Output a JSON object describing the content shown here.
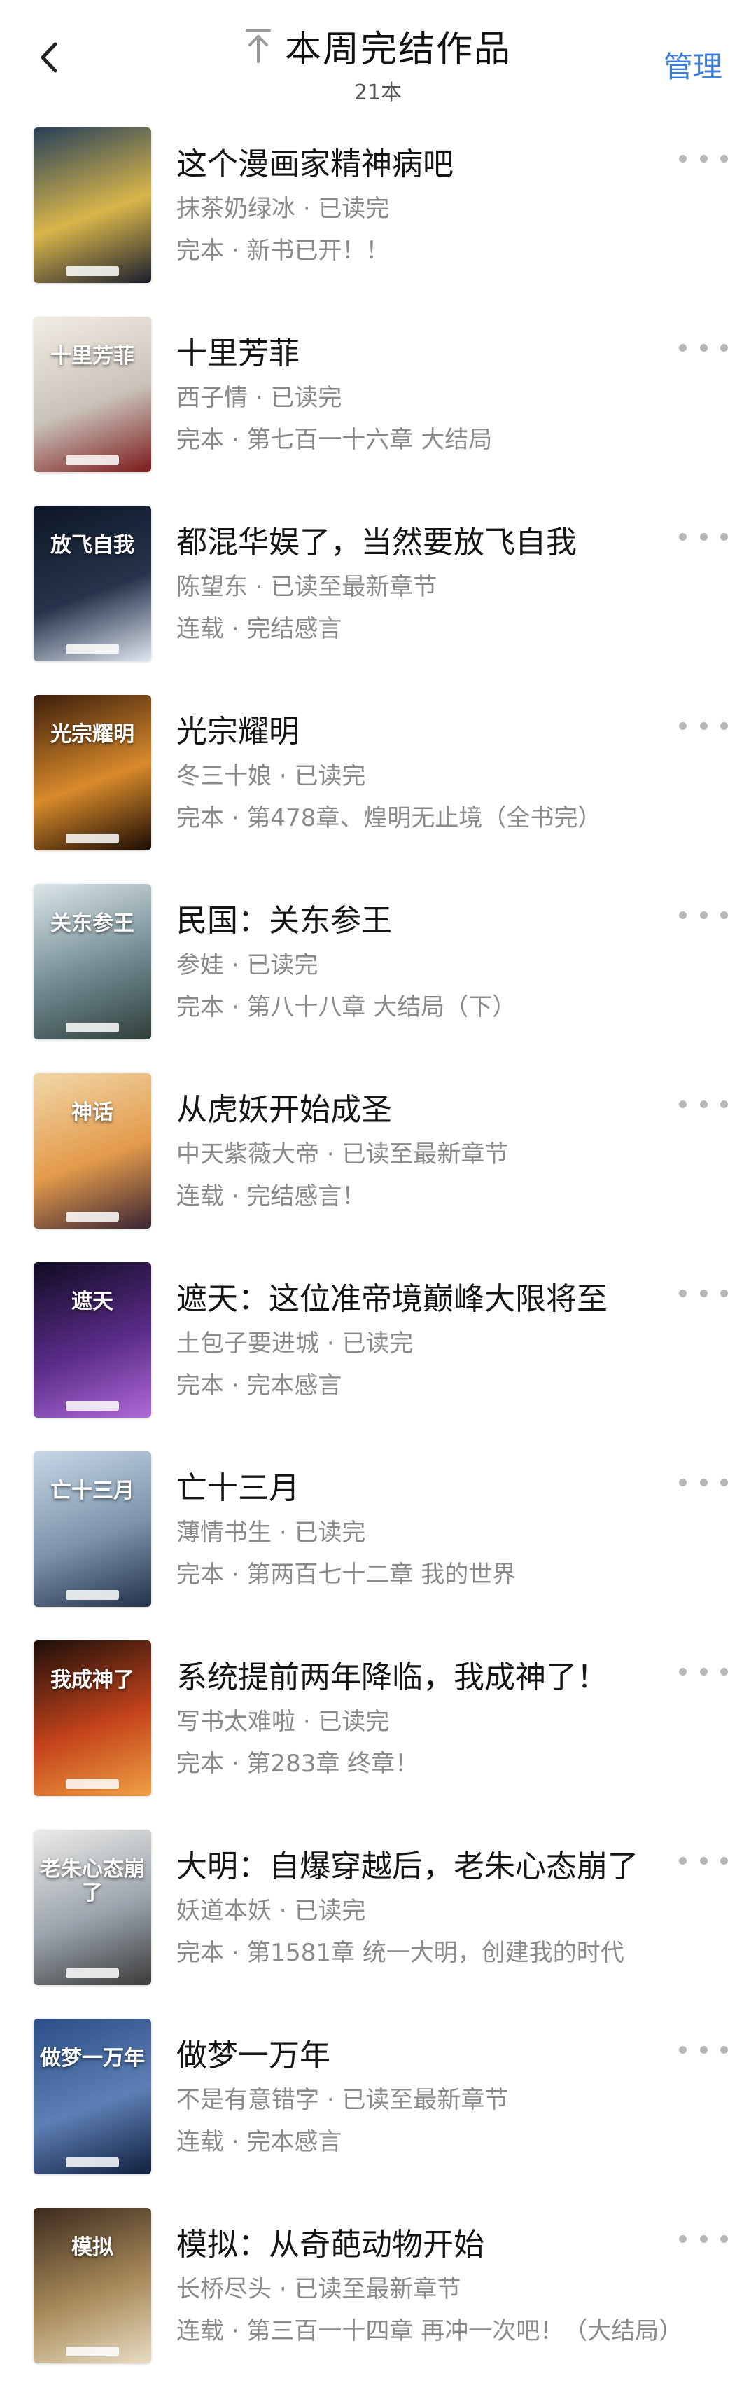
{
  "header": {
    "back_icon": "chevron-left-icon",
    "pin_icon": "pin-top-icon",
    "title": "本周完结作品",
    "subtitle": "21本",
    "manage_label": "管理",
    "accent_color": "#3b7dd8"
  },
  "books": [
    {
      "title": "这个漫画家精神病吧",
      "author": "抹茶奶绿冰",
      "progress": "已读完",
      "serial": "完本",
      "latest": "新书已开！！",
      "cover_text": "",
      "cover_colors": [
        "#26405a",
        "#d9b64a",
        "#1c1f2e"
      ]
    },
    {
      "title": "十里芳菲",
      "author": "西子情",
      "progress": "已读完",
      "serial": "完本",
      "latest": "第七百一十六章 大结局",
      "cover_text": "十里芳菲",
      "cover_colors": [
        "#f2ede4",
        "#c9c2b8",
        "#7b1a1a"
      ]
    },
    {
      "title": "都混华娱了，当然要放飞自我",
      "author": "陈望东",
      "progress": "已读至最新章节",
      "serial": "连载",
      "latest": "完结感言",
      "cover_text": "放飞自我",
      "cover_colors": [
        "#0d1626",
        "#25344c",
        "#dfe6f0"
      ]
    },
    {
      "title": "光宗耀明",
      "author": "冬三十娘",
      "progress": "已读完",
      "serial": "完本",
      "latest": "第478章、煌明无止境（全书完）",
      "cover_text": "光宗耀明",
      "cover_colors": [
        "#3b1e0c",
        "#d98a2b",
        "#1a0b04"
      ]
    },
    {
      "title": "民国：关东参王",
      "author": "参娃",
      "progress": "已读完",
      "serial": "完本",
      "latest": "第八十八章 大结局（下）",
      "cover_text": "关东参王",
      "cover_colors": [
        "#dce6ea",
        "#6f8a92",
        "#2f3f3a"
      ]
    },
    {
      "title": "从虎妖开始成圣",
      "author": "中天紫薇大帝",
      "progress": "已读至最新章节",
      "serial": "连载",
      "latest": "完结感言！",
      "cover_text": "神话",
      "cover_colors": [
        "#f1d7a8",
        "#e39a4b",
        "#3a2433"
      ]
    },
    {
      "title": "遮天：这位准帝境巅峰大限将至",
      "author": "土包子要进城",
      "progress": "已读完",
      "serial": "完本",
      "latest": "完本感言",
      "cover_text": "遮天",
      "cover_colors": [
        "#100b22",
        "#5b2c8a",
        "#b06ad6"
      ]
    },
    {
      "title": "亡十三月",
      "author": "薄情书生",
      "progress": "已读完",
      "serial": "完本",
      "latest": "第两百七十二章 我的世界",
      "cover_text": "亡十三月",
      "cover_colors": [
        "#c6d7e6",
        "#7b93ab",
        "#22324a"
      ]
    },
    {
      "title": "系统提前两年降临，我成神了！",
      "author": "写书太难啦",
      "progress": "已读完",
      "serial": "完本",
      "latest": "第283章 终章！",
      "cover_text": "我成神了",
      "cover_colors": [
        "#1c0f0a",
        "#c4431b",
        "#f0a044"
      ]
    },
    {
      "title": "大明：自爆穿越后，老朱心态崩了",
      "author": "妖道本妖",
      "progress": "已读完",
      "serial": "完本",
      "latest": "第1581章 统一大明，创建我的时代",
      "cover_text": "老朱心态崩了",
      "cover_colors": [
        "#ecebe8",
        "#9aa3ad",
        "#3b3b3b"
      ]
    },
    {
      "title": "做梦一万年",
      "author": "不是有意错字",
      "progress": "已读至最新章节",
      "serial": "连载",
      "latest": "完本感言",
      "cover_text": "做梦一万年",
      "cover_colors": [
        "#2b4f86",
        "#5d7fb5",
        "#10203d"
      ]
    },
    {
      "title": "模拟：从奇葩动物开始",
      "author": "长桥尽头",
      "progress": "已读至最新章节",
      "serial": "连载",
      "latest": "第三百一十四章 再冲一次吧！（大结局）",
      "cover_text": "模拟",
      "cover_colors": [
        "#3c2a1d",
        "#a98a5a",
        "#e8dcc2"
      ]
    }
  ],
  "separator": "·",
  "more_icon": "more-dots-icon"
}
